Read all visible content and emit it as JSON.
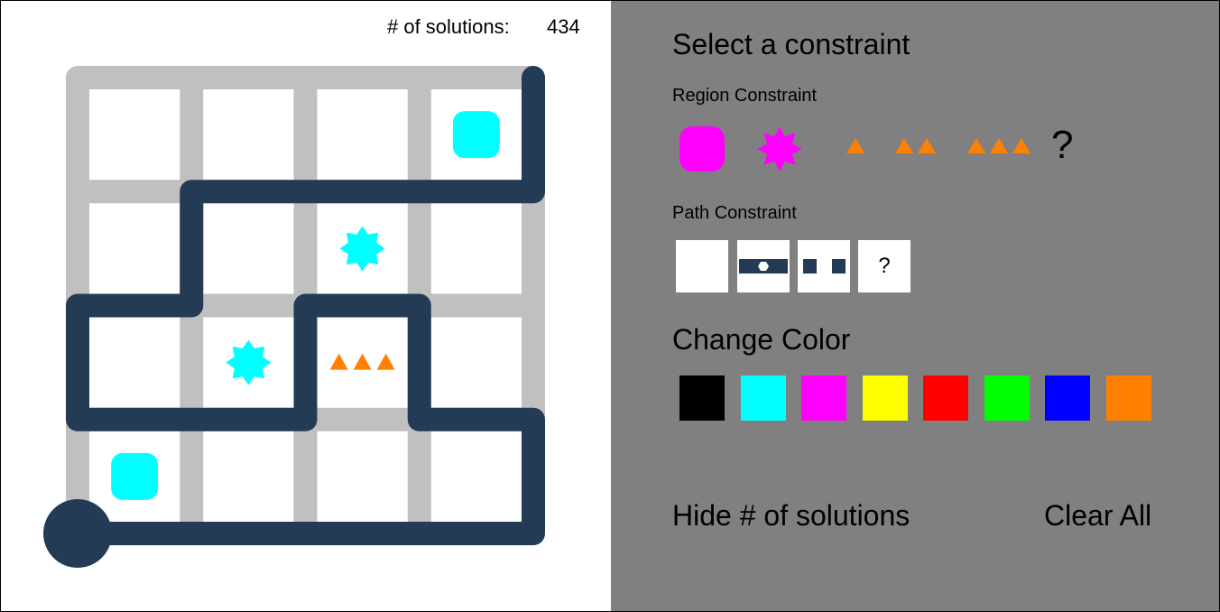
{
  "solutions": {
    "label": "# of solutions:",
    "count": "434"
  },
  "puzzle": {
    "grid_size": [
      4,
      4
    ],
    "grid_color": "#c0c0c0",
    "path_color": "#243b55",
    "path_vertices_col_row": [
      [
        0,
        4
      ],
      [
        4,
        4
      ],
      [
        4,
        3
      ],
      [
        3,
        3
      ],
      [
        3,
        2
      ],
      [
        2,
        2
      ],
      [
        2,
        3
      ],
      [
        0,
        3
      ],
      [
        0,
        2
      ],
      [
        1,
        2
      ],
      [
        1,
        1
      ],
      [
        4,
        1
      ],
      [
        4,
        0
      ]
    ],
    "cells": [
      {
        "col": 3,
        "row": 0,
        "symbol": "square",
        "color": "#00ffff"
      },
      {
        "col": 2,
        "row": 1,
        "symbol": "star",
        "color": "#00ffff"
      },
      {
        "col": 1,
        "row": 2,
        "symbol": "star",
        "color": "#00ffff"
      },
      {
        "col": 2,
        "row": 2,
        "symbol": "triangles-3",
        "color": "#ff8000"
      },
      {
        "col": 0,
        "row": 3,
        "symbol": "square",
        "color": "#00ffff"
      }
    ]
  },
  "panel": {
    "title": "Select a constraint",
    "region_heading": "Region Constraint",
    "region_constraints": [
      {
        "name": "square",
        "icon": "rounded-square-icon",
        "color": "#ff00ff"
      },
      {
        "name": "star",
        "icon": "star-icon",
        "color": "#ff00ff"
      },
      {
        "name": "triangle-1",
        "icon": "triangle-icon",
        "color": "#ff8000"
      },
      {
        "name": "triangle-2",
        "icon": "triangle-icon",
        "color": "#ff8000"
      },
      {
        "name": "triangle-3",
        "icon": "triangle-icon",
        "color": "#ff8000"
      }
    ],
    "region_unknown": "?",
    "path_heading": "Path Constraint",
    "path_constraints": [
      "none",
      "dot",
      "gap"
    ],
    "path_unknown": "?",
    "color_heading": "Change Color",
    "colors": [
      "#000000",
      "#00ffff",
      "#ff00ff",
      "#ffff00",
      "#ff0000",
      "#00ff00",
      "#0000ff",
      "#ff8000"
    ],
    "hide_solutions": "Hide # of solutions",
    "clear_all": "Clear All"
  }
}
